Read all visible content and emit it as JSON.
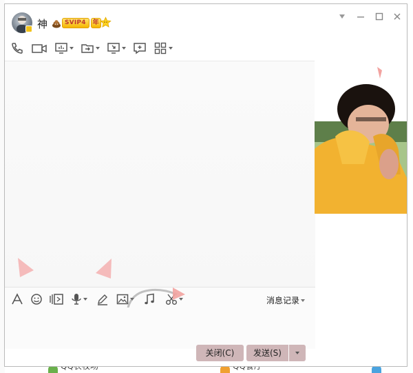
{
  "contact": {
    "name": "神",
    "svip_label": "SVIP4",
    "year_label": "年"
  },
  "window_controls": {
    "dropdown_icon": "triangle-down-icon",
    "minimize_icon": "minimize-icon",
    "maximize_icon": "maximize-icon",
    "close_icon": "close-icon"
  },
  "top_toolbar": [
    {
      "name": "voice-call",
      "icon": "phone-icon",
      "has_menu": false
    },
    {
      "name": "video-call",
      "icon": "video-camera-icon",
      "has_menu": false
    },
    {
      "name": "remote-demo",
      "icon": "presentation-icon",
      "has_menu": true
    },
    {
      "name": "send-file",
      "icon": "folder-transfer-icon",
      "has_menu": true
    },
    {
      "name": "remote-desktop",
      "icon": "monitor-icon",
      "has_menu": true
    },
    {
      "name": "create-discussion",
      "icon": "chat-add-icon",
      "has_menu": false
    },
    {
      "name": "apps",
      "icon": "grid-apps-icon",
      "has_menu": true
    }
  ],
  "input_toolbar": [
    {
      "name": "font",
      "icon": "font-a-icon"
    },
    {
      "name": "emoji",
      "icon": "smiley-icon"
    },
    {
      "name": "shake",
      "icon": "shake-window-icon"
    },
    {
      "name": "voice-message",
      "icon": "microphone-icon"
    },
    {
      "name": "handwriting",
      "icon": "pen-icon"
    },
    {
      "name": "picture",
      "icon": "image-icon"
    },
    {
      "name": "music",
      "icon": "music-note-icon"
    },
    {
      "name": "screenshot",
      "icon": "scissors-icon"
    }
  ],
  "history_label": "消息记录",
  "buttons": {
    "close_label": "关闭(C)",
    "send_label": "发送(S)"
  },
  "background": {
    "bottom_items": [
      "QQ农牧场",
      "QQ餐厅"
    ]
  },
  "colors": {
    "button_bg": "#cfb6b8",
    "badge_gold": "#f6b500",
    "badge_red": "#c0392b",
    "ear_pink": "#f4b0b0"
  }
}
